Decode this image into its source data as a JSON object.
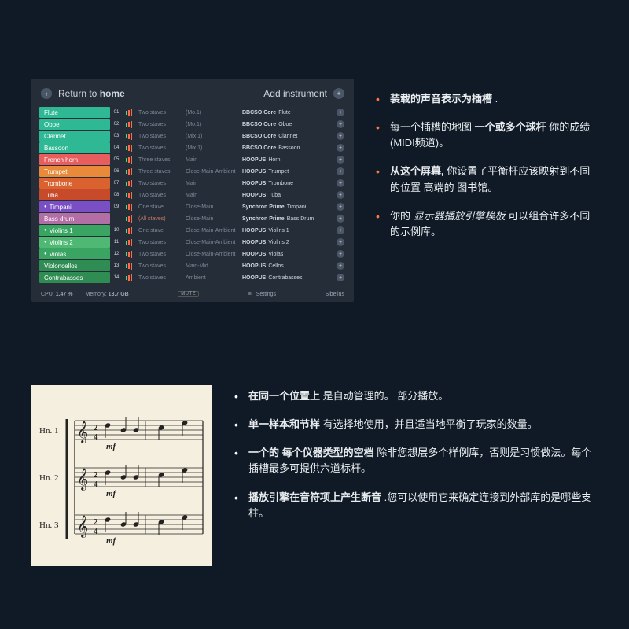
{
  "panel": {
    "return_prefix": "Return to ",
    "return_home": "home",
    "add_instrument": "Add instrument",
    "rows": [
      {
        "name": "Flute",
        "color": "#2fb894",
        "ch": "01",
        "staves": "Two staves",
        "mix": "(Mo.1)",
        "lib_b": "BBCSO Core",
        "lib_r": "Flute"
      },
      {
        "name": "Oboe",
        "color": "#2fb894",
        "ch": "02",
        "staves": "Two staves",
        "mix": "(Mo.1)",
        "lib_b": "BBCSO Core",
        "lib_r": "Oboe"
      },
      {
        "name": "Clarinet",
        "color": "#2fb894",
        "ch": "03",
        "staves": "Two staves",
        "mix": "(Mix 1)",
        "lib_b": "BBCSO Core",
        "lib_r": "Clarinet"
      },
      {
        "name": "Bassoon",
        "color": "#2fb894",
        "ch": "04",
        "staves": "Two staves",
        "mix": "(Mix 1)",
        "lib_b": "BBCSO Core",
        "lib_r": "Bassoon"
      },
      {
        "name": "French horn",
        "color": "#e85d5d",
        "ch": "05",
        "staves": "Three staves",
        "mix": "Main",
        "lib_b": "HOOPUS",
        "lib_r": "Horn"
      },
      {
        "name": "Trumpet",
        "color": "#e88a3a",
        "ch": "06",
        "staves": "Three staves",
        "mix": "Close-Main-Ambient",
        "lib_b": "HOOPUS",
        "lib_r": "Trumpet"
      },
      {
        "name": "Trombone",
        "color": "#d9622f",
        "ch": "07",
        "staves": "Two staves",
        "mix": "Main",
        "lib_b": "HOOPUS",
        "lib_r": "Trombone"
      },
      {
        "name": "Tuba",
        "color": "#c74a2a",
        "ch": "08",
        "staves": "Two staves",
        "mix": "Main",
        "lib_b": "HOOPUS",
        "lib_r": "Tuba"
      },
      {
        "name": "Timpani",
        "color": "#7a4fc4",
        "ch": "09",
        "staves": "One stave",
        "mix": "Close-Main",
        "lib_b": "Synchron Prime",
        "lib_r": "Timpani",
        "dot": true
      },
      {
        "name": "Bass drum",
        "color": "#b36fa5",
        "ch": "",
        "staves": "(All staves)",
        "mix": "Close-Main",
        "lib_b": "Synchron Prime",
        "lib_r": "Bass Drum",
        "alt": true
      },
      {
        "name": "Violins 1",
        "color": "#3aa563",
        "ch": "10",
        "staves": "One stave",
        "mix": "Close-Main-Ambient",
        "lib_b": "HOOPUS",
        "lib_r": "Violins 1",
        "dot": true
      },
      {
        "name": "Violins 2",
        "color": "#4fb873",
        "ch": "11",
        "staves": "Two staves",
        "mix": "Close-Main-Ambient",
        "lib_b": "HOOPUS",
        "lib_r": "Violins 2",
        "dot": true
      },
      {
        "name": "Violas",
        "color": "#3aa563",
        "ch": "12",
        "staves": "Two staves",
        "mix": "Close-Main-Ambient",
        "lib_b": "HOOPUS",
        "lib_r": "Violas",
        "dot": true
      },
      {
        "name": "Violoncellos",
        "color": "#2f8c52",
        "ch": "13",
        "staves": "Two staves",
        "mix": "Main-Mid",
        "lib_b": "HOOPUS",
        "lib_r": "Cellos"
      },
      {
        "name": "Contrabasses",
        "color": "#2f8c52",
        "ch": "14",
        "staves": "Two staves",
        "mix": "Ambient",
        "lib_b": "HOOPUS",
        "lib_r": "Contrabasses"
      }
    ],
    "footer": {
      "cpu_label": "CPU:",
      "cpu_val": "1.47 %",
      "mem_label": "Memory:",
      "mem_val": "13.7 GB",
      "mute": "MUTE",
      "settings": "Settings",
      "host": "Sibelius"
    }
  },
  "bullets_top": [
    {
      "pre": "",
      "b": "装载的声音表示为插槽",
      "post": " ."
    },
    {
      "pre": "每一个插槽的地图 ",
      "b": "一个或多个球杆",
      "post": " 你的成绩 (MIDI频道)。"
    },
    {
      "pre": "",
      "b": "从这个屏幕,",
      "post": " 你设置了平衡杆应该映射到不同的位置 高端的 图书馆。"
    },
    {
      "pre": "你的 ",
      "i": "显示器播放引擎模板",
      "post": " 可以组合许多不同的示例库。"
    }
  ],
  "score": {
    "labels": [
      "Hn. 1",
      "Hn. 2",
      "Hn. 3"
    ],
    "dynamic": "mf",
    "time": "2/4"
  },
  "bullets_bottom": [
    {
      "b": "在同一个位置上",
      "post": " 是自动管理的。 部分播放。"
    },
    {
      "b": "单一样本和节样",
      "post": " 有选择地使用，并且适当地平衡了玩家的数量。"
    },
    {
      "b": "一个的 每个仪器类型的空档",
      "post": " 除非您想层多个样例库，否则是习惯做法。每个插槽最多可提供六道标杆。"
    },
    {
      "b": "播放引擎在音符项上产生断音",
      "post": " .您可以使用它来确定连接到外部库的是哪些支柱。"
    }
  ]
}
